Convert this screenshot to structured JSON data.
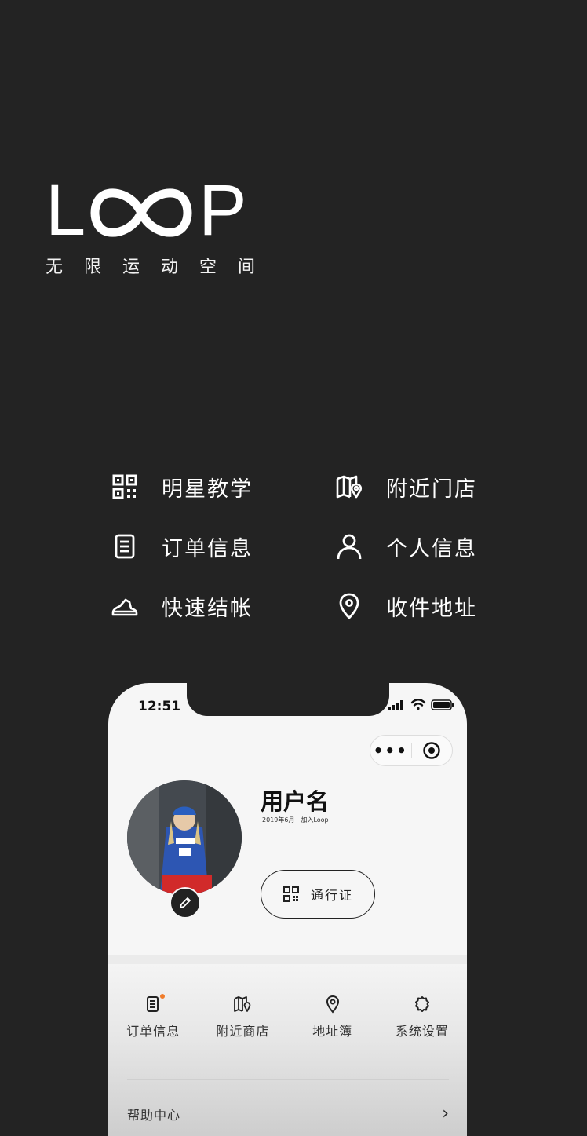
{
  "logo": {
    "letter_l": "L",
    "letter_p": "P",
    "tagline": "无限运动空间"
  },
  "features": [
    {
      "label": "明星教学",
      "icon": "qr-code-icon"
    },
    {
      "label": "附近门店",
      "icon": "map-pin-icon"
    },
    {
      "label": "订单信息",
      "icon": "document-icon"
    },
    {
      "label": "个人信息",
      "icon": "person-icon"
    },
    {
      "label": "快速结帐",
      "icon": "sneaker-icon"
    },
    {
      "label": "收件地址",
      "icon": "location-icon"
    }
  ],
  "phone": {
    "status": {
      "time": "12:51"
    },
    "capsule": {
      "more": "•••"
    },
    "profile": {
      "username": "用户名",
      "joined_date": "2019年6月",
      "joined_text": "加入Loop",
      "pass_label": "通行证"
    },
    "menu": [
      {
        "label": "订单信息",
        "icon": "order-icon"
      },
      {
        "label": "附近商店",
        "icon": "map-icon"
      },
      {
        "label": "地址簿",
        "icon": "location-icon"
      },
      {
        "label": "系统设置",
        "icon": "gear-icon"
      }
    ],
    "help": {
      "label": "帮助中心",
      "arrow": "›"
    }
  },
  "colors": {
    "background": "#232323",
    "phone_screen": "#f6f6f6",
    "accent_dot": "#f07c2a"
  }
}
